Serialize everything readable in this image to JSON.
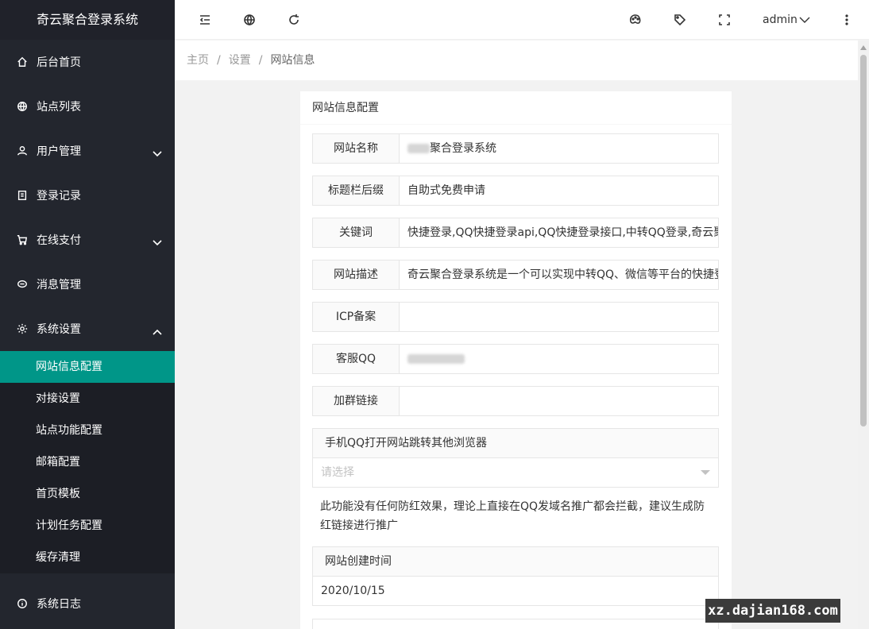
{
  "sidebar": {
    "app_title": "奇云聚合登录系统",
    "items": [
      {
        "label": "后台首页",
        "icon": "home-icon"
      },
      {
        "label": "站点列表",
        "icon": "globe-icon"
      },
      {
        "label": "用户管理",
        "icon": "user-icon",
        "expandable": true
      },
      {
        "label": "登录记录",
        "icon": "document-icon"
      },
      {
        "label": "在线支付",
        "icon": "cart-icon",
        "expandable": true
      },
      {
        "label": "消息管理",
        "icon": "chat-icon"
      },
      {
        "label": "系统设置",
        "icon": "gear-icon",
        "expanded": true
      }
    ],
    "sub_items": [
      "网站信息配置",
      "对接设置",
      "站点功能配置",
      "邮箱配置",
      "首页模板",
      "计划任务配置",
      "缓存清理"
    ],
    "active_sub": "网站信息配置",
    "bottom_item": {
      "label": "系统日志",
      "icon": "info-icon"
    }
  },
  "header": {
    "user": "admin",
    "icons": [
      "menu-collapse-icon",
      "globe-icon",
      "refresh-icon",
      "palette-icon",
      "tag-icon",
      "fullscreen-icon",
      "more-icon"
    ]
  },
  "breadcrumb": {
    "items": [
      "主页",
      "设置",
      "网站信息"
    ],
    "separator": "/"
  },
  "card": {
    "title": "网站信息配置",
    "fields": [
      {
        "label": "网站名称",
        "value": "聚合登录系统"
      },
      {
        "label": "标题栏后缀",
        "value": "自助式免费申请"
      },
      {
        "label": "关键词",
        "value": "快捷登录,QQ快捷登录api,QQ快捷登录接口,中转QQ登录,奇云聚"
      },
      {
        "label": "网站描述",
        "value": "奇云聚合登录系统是一个可以实现中转QQ、微信等平台的快捷登"
      },
      {
        "label": "ICP备案",
        "value": ""
      },
      {
        "label": "客服QQ",
        "value": ""
      },
      {
        "label": "加群链接",
        "value": ""
      }
    ],
    "browser_jump": {
      "label": "手机QQ打开网站跳转其他浏览器",
      "placeholder": "请选择"
    },
    "tip": "此功能没有任何防红效果，理论上直接在QQ发域名推广都会拦截，建议生成防红链接进行推广",
    "create_time": {
      "label": "网站创建时间",
      "value": "2020/10/15"
    }
  },
  "watermark": "xz.dajian168.com",
  "colors": {
    "sidebar_bg": "#23262e",
    "active": "#009688",
    "page_bg": "#f2f2f2"
  }
}
